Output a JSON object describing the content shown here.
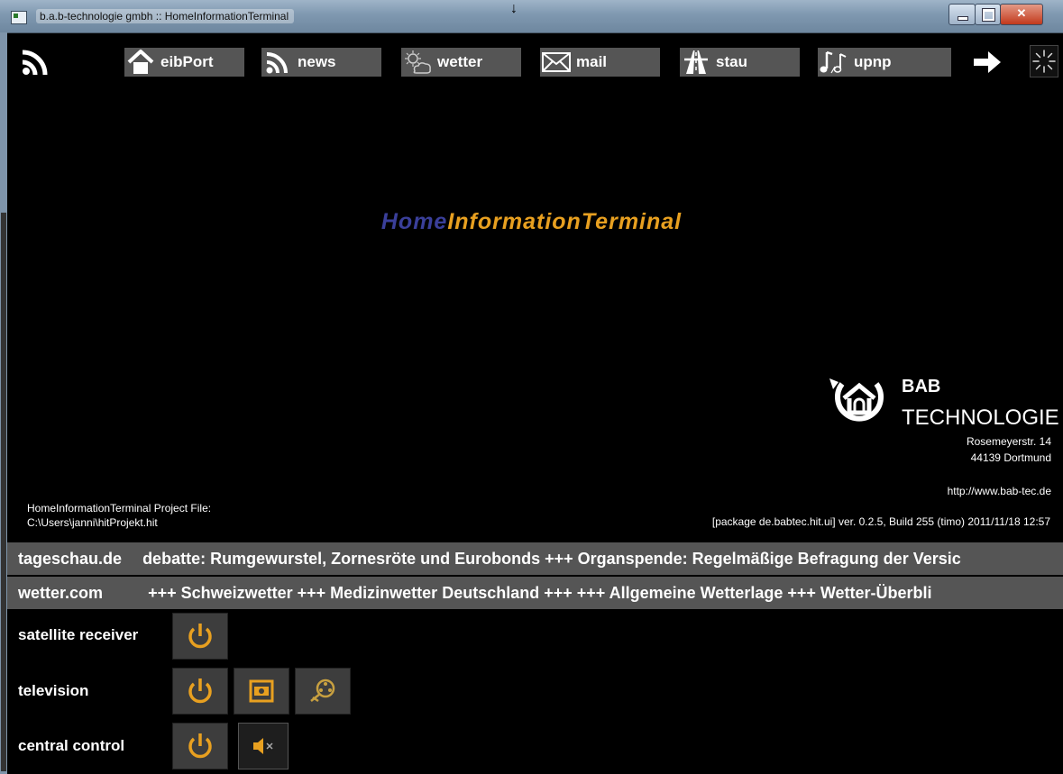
{
  "window": {
    "title": "b.a.b-technologie gmbh :: HomeInformationTerminal",
    "controls": [
      "minimize",
      "maximize",
      "close"
    ]
  },
  "nav": {
    "left_icon": "rss-icon",
    "items": [
      {
        "label": "eibPort",
        "icon": "home-icon"
      },
      {
        "label": "news",
        "icon": "rss-icon"
      },
      {
        "label": "wetter",
        "icon": "weather-icon"
      },
      {
        "label": "mail",
        "icon": "mail-icon"
      },
      {
        "label": "stau",
        "icon": "highway-icon"
      },
      {
        "label": "upnp",
        "icon": "music-note-icon"
      }
    ],
    "right_icons": [
      "arrow-right-icon",
      "loading-spinner-icon"
    ]
  },
  "main": {
    "title_parts": [
      "Home",
      "Information",
      "Terminal"
    ],
    "logo": {
      "line1": "BAB",
      "line2": "TECHNOLOGIE"
    },
    "address": {
      "street": "Rosemeyerstr. 14",
      "city": "44139 Dortmund",
      "url": "http://www.bab-tec.de"
    },
    "project_label": "HomeInformationTerminal Project File:",
    "project_path": "C:\\Users\\janni\\hitProjekt.hit",
    "version": "[package de.babtec.hit.ui] ver. 0.2.5, Build 255 (timo) 2011/11/18 12:57"
  },
  "tickers": [
    {
      "source": "tageschau.de",
      "text": "debatte: Rumgewurstel, Zornesröte und Eurobonds  +++  Organspende: Regelmäßige Befragung der Versic"
    },
    {
      "source": "wetter.com",
      "text": "+++  Schweizwetter  +++  Medizinwetter Deutschland  +++  +++  Allgemeine Wetterlage  +++  Wetter-Überbli"
    }
  ],
  "devices": [
    {
      "label": "satellite receiver",
      "buttons": [
        "power-icon"
      ]
    },
    {
      "label": "television",
      "buttons": [
        "power-icon",
        "tv-picture-icon",
        "tv-film-icon"
      ]
    },
    {
      "label": "central control",
      "buttons": [
        "power-icon",
        "mute-icon"
      ]
    }
  ],
  "colors": {
    "background": "#000000",
    "bar": "#555555",
    "accent_orange": "#e8a020",
    "accent_blue": "#3a3f9a"
  }
}
